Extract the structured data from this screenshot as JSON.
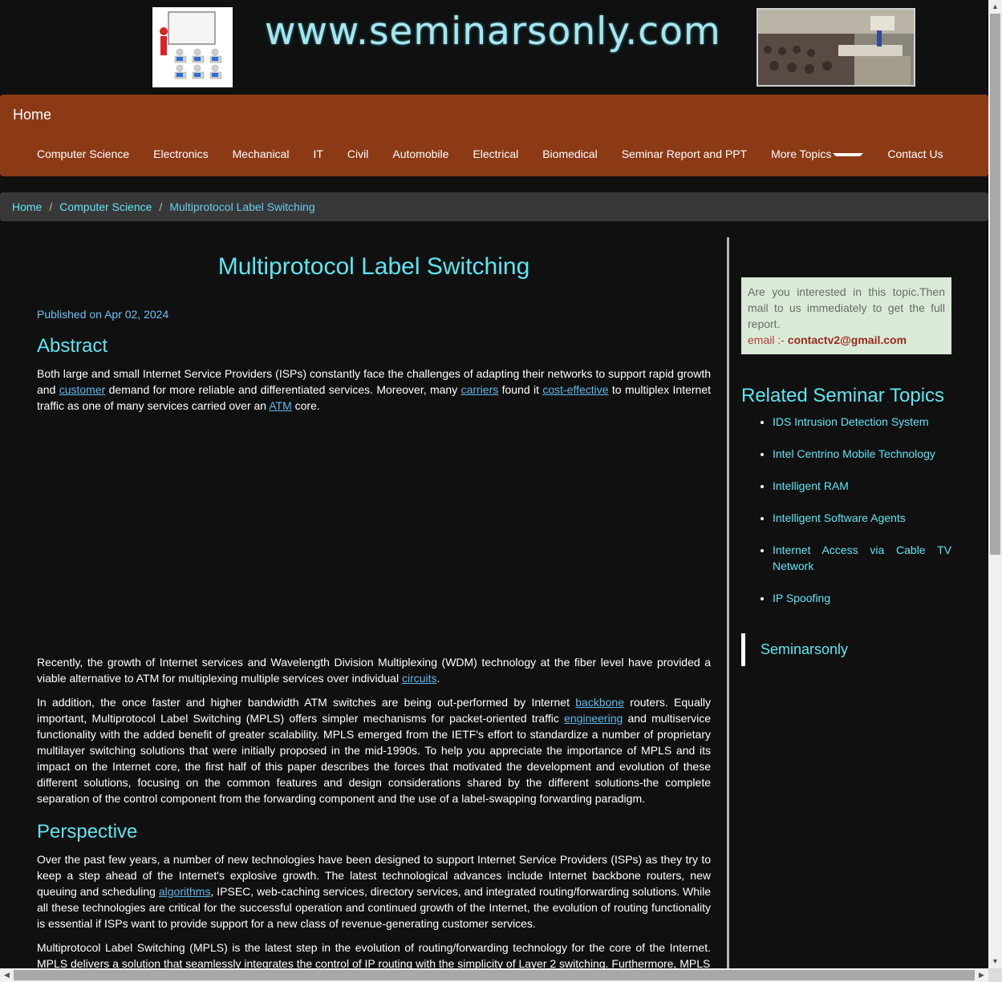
{
  "banner": {
    "title": "www.seminarsonly.com"
  },
  "navbar": {
    "brand": "Home",
    "links": [
      "Computer Science",
      "Electronics",
      "Mechanical",
      "IT",
      "Civil",
      "Automobile",
      "Electrical",
      "Biomedical",
      "Seminar Report and PPT",
      "More Topics",
      "Contact Us"
    ]
  },
  "breadcrumb": {
    "home": "Home",
    "category": "Computer Science",
    "current": "Multiprotocol Label Switching"
  },
  "article": {
    "title": "Multiprotocol Label Switching",
    "published": "Published on Apr 02, 2024",
    "abstract_heading": "Abstract",
    "p1": {
      "a": "Both large and small Internet Service Providers (ISPs) constantly face the challenges of adapting their networks to support rapid growth and ",
      "link1": "customer",
      "b": " demand for more reliable and differentiated services. Moreover, many ",
      "link2": "carriers",
      "c": " found it ",
      "link3": "cost-effective",
      "d": " to multiplex Internet traffic as one of many services carried over an ",
      "link4": "ATM",
      "e": " core."
    },
    "p2": {
      "a": "Recently, the growth of Internet services and Wavelength Division Multiplexing (WDM) technology at the fiber level have provided a viable alternative to ATM for multiplexing multiple services over individual ",
      "link1": "circuits",
      "b": "."
    },
    "p3": {
      "a": "In addition, the once faster and higher bandwidth ATM switches are being out-performed by Internet ",
      "link1": "backbone",
      "b": " routers. Equally important, Multiprotocol Label Switching (MPLS) offers simpler mechanisms for packet-oriented traffic ",
      "link2": "engineering",
      "c": " and multiservice functionality with the added benefit of greater scalability. MPLS emerged from the IETF's effort to standardize a number of proprietary multilayer switching solutions that were initially proposed in the mid-1990s. To help you appreciate the importance of MPLS and its impact on the Internet core, the first half of this paper describes the forces that motivated the development and evolution of these different solutions, focusing on the common features and design considerations shared by the different solutions-the complete separation of the control component from the forwarding component and the use of a label-swapping forwarding paradigm."
    },
    "perspective_heading": "Perspective",
    "p4": {
      "a": "Over the past few years, a number of new technologies have been designed to support Internet Service Providers (ISPs) as they try to keep a step ahead of the Internet's explosive growth. The latest technological advances include Internet backbone routers, new queuing and scheduling ",
      "link1": "algorithms",
      "b": ", IPSEC, web-caching services, directory services, and integrated routing/forwarding solutions. While all these technologies are critical for the successful operation and continued growth of the Internet, the evolution of routing functionality is essential if ISPs want to provide support for a new class of revenue-generating customer services."
    },
    "p5": "Multiprotocol Label Switching (MPLS) is the latest step in the evolution of routing/forwarding technology for the core of the Internet. MPLS delivers a solution that seamlessly integrates the control of IP routing with the simplicity of Layer 2 switching. Furthermore, MPLS"
  },
  "sidebar": {
    "contact_text": "Are you interested in this topic.Then mail to us immediately to get the full report.",
    "email_label": "email :- ",
    "email": "contactv2@gmail.com",
    "related_title": "Related Seminar Topics",
    "related": [
      "IDS Intrusion Detection System",
      "Intel Centrino Mobile Technology",
      "Intelligent RAM",
      "Intelligent Software Agents",
      "Internet Access via Cable TV Network",
      "IP Spoofing"
    ],
    "footer_brand": "Seminarsonly"
  },
  "colors": {
    "background": "#101010",
    "navbar": "#8c3a16",
    "heading": "#5ee6f2",
    "link": "#5fb8ea"
  }
}
